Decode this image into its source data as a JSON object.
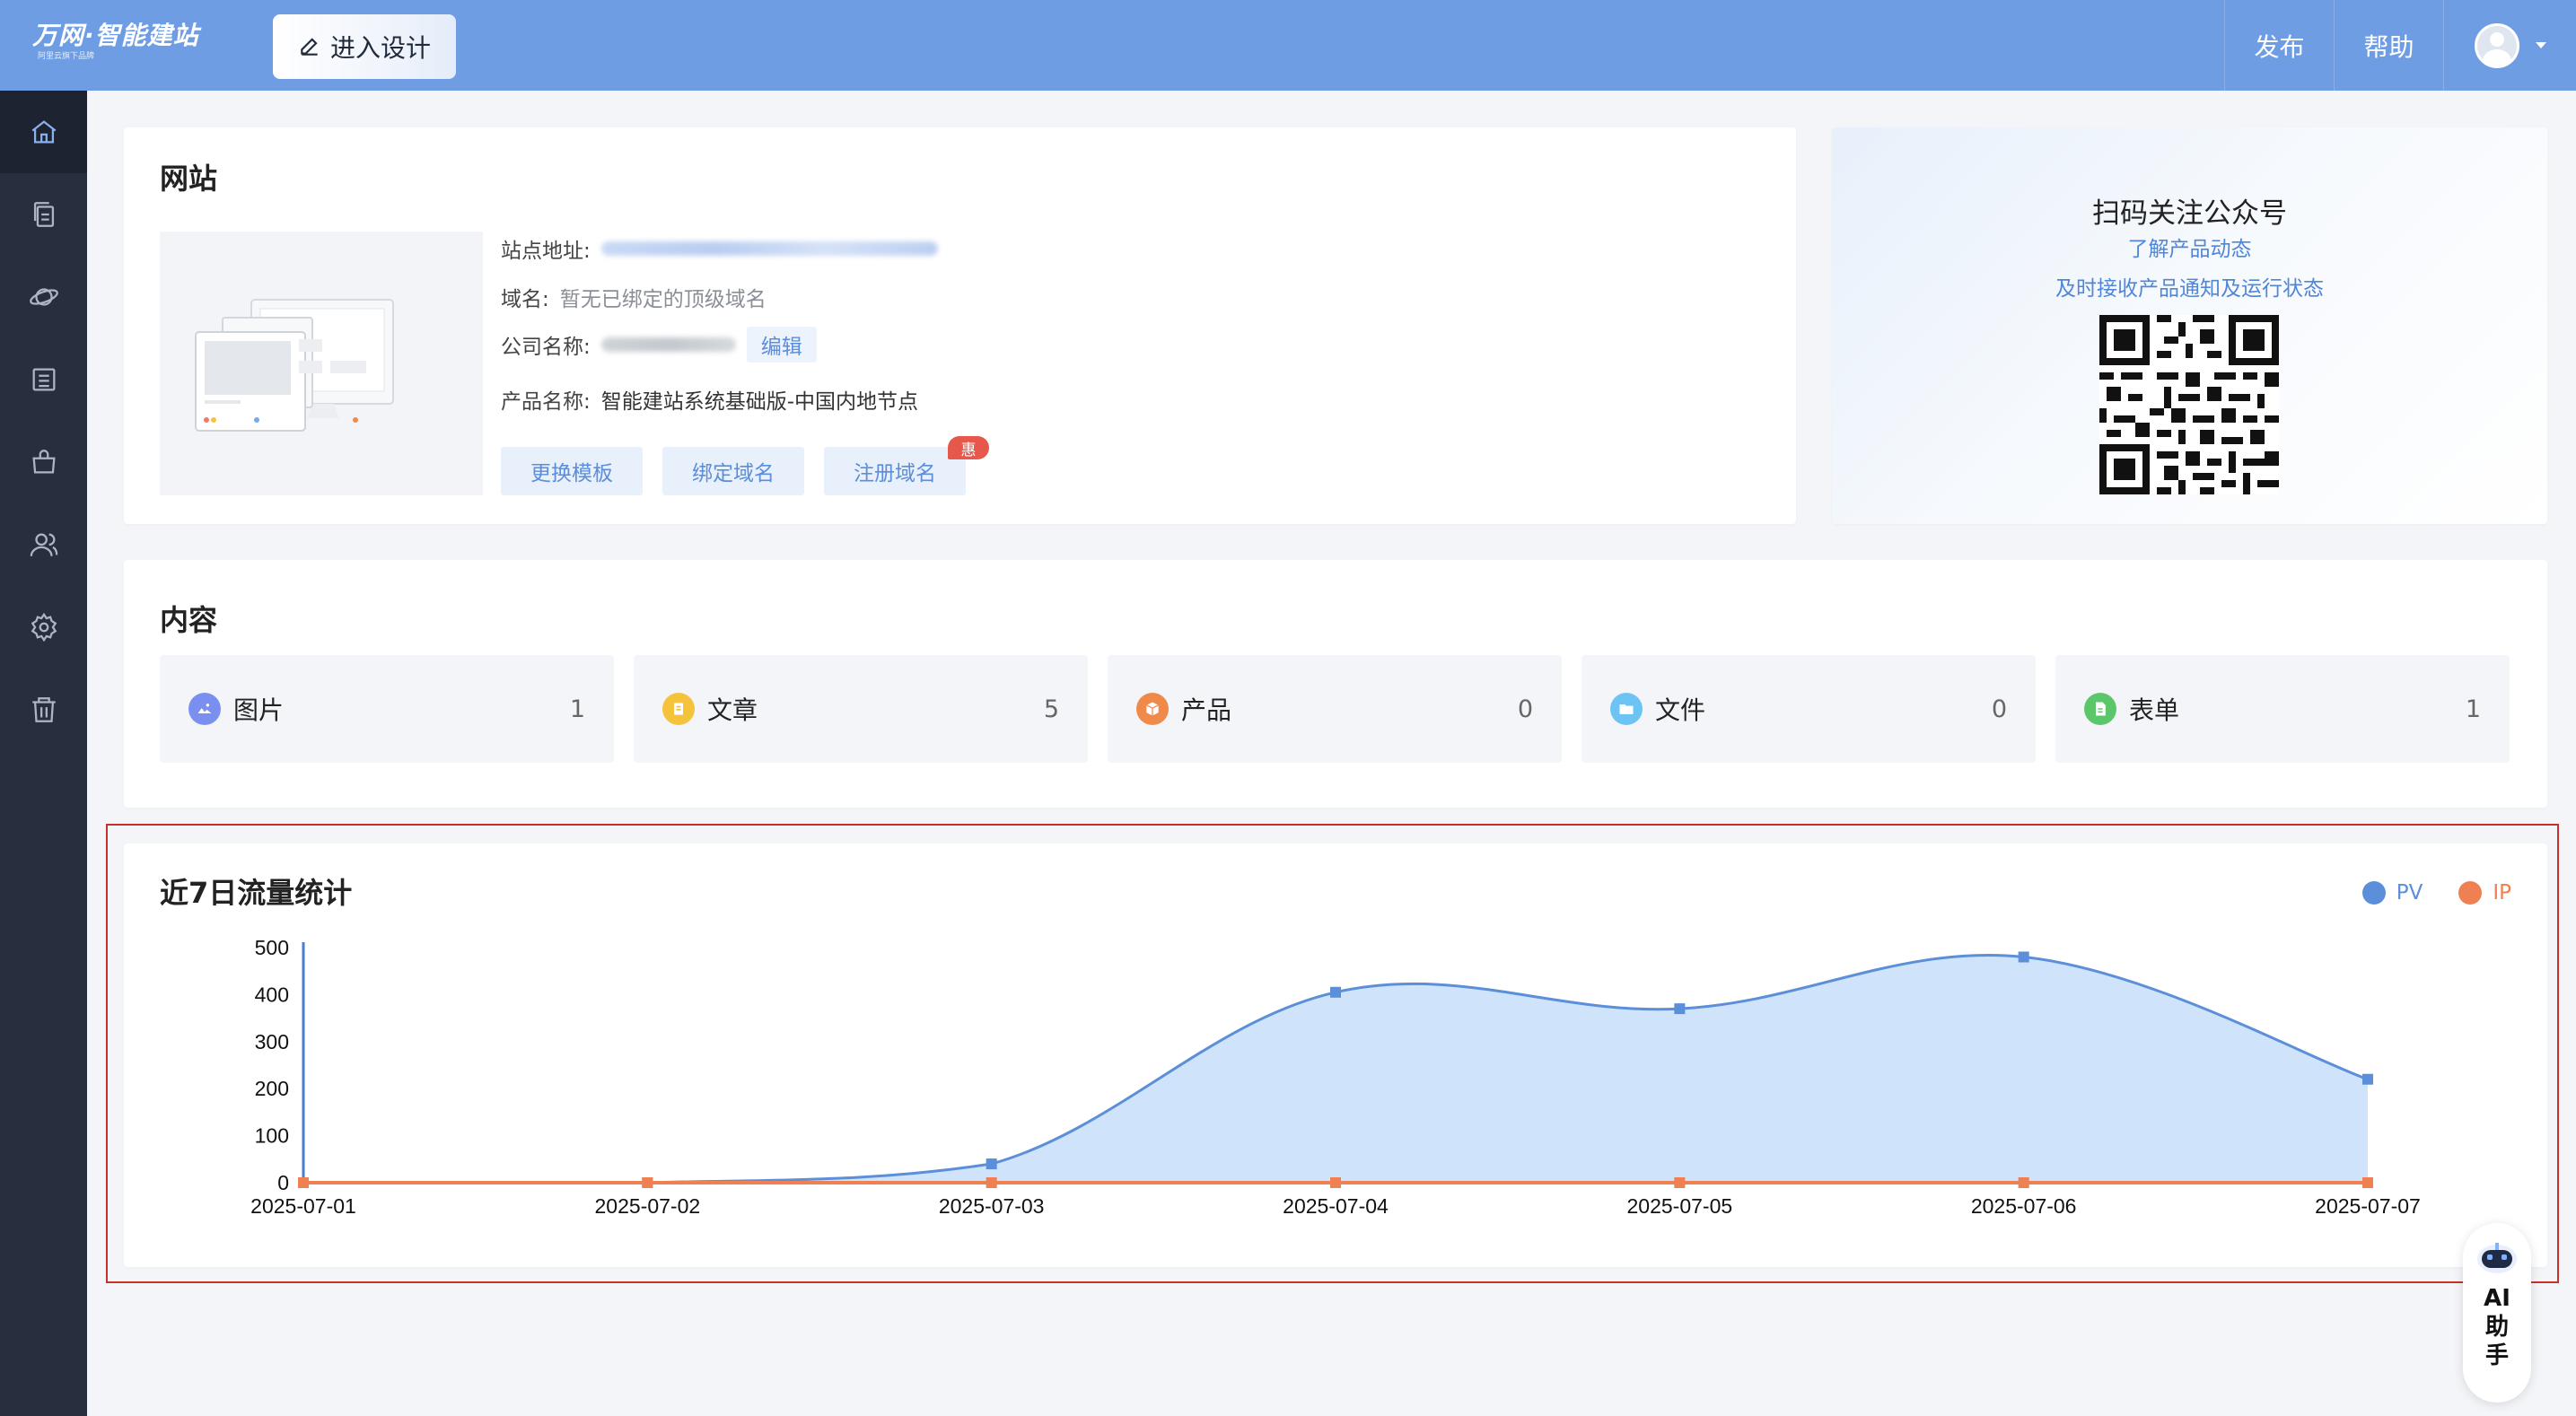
{
  "topbar": {
    "logo_text": "万网·智能建站",
    "logo_sub": "阿里云旗下品牌",
    "design_button": "进入设计",
    "publish": "发布",
    "help": "帮助"
  },
  "sidebar": {
    "items": [
      {
        "icon": "home-icon",
        "active": true
      },
      {
        "icon": "pages-icon"
      },
      {
        "icon": "planet-icon"
      },
      {
        "icon": "list-icon"
      },
      {
        "icon": "shop-icon"
      },
      {
        "icon": "users-icon"
      },
      {
        "icon": "gear-icon"
      },
      {
        "icon": "trash-icon"
      }
    ]
  },
  "website": {
    "title": "网站",
    "site_address_label": "站点地址:",
    "domain_label": "域名:",
    "domain_value": "暂无已绑定的顶级域名",
    "company_label": "公司名称:",
    "edit": "编辑",
    "product_label": "产品名称:",
    "product_value": "智能建站系统基础版-中国内地节点",
    "change_template": "更换模板",
    "bind_domain": "绑定域名",
    "register_domain": "注册域名",
    "badge": "惠"
  },
  "qr": {
    "title": "扫码关注公众号",
    "line1": "了解产品动态",
    "line2": "及时接收产品通知及运行状态"
  },
  "content": {
    "title": "内容",
    "items": [
      {
        "label": "图片",
        "count": "1",
        "color": "#7b8ff0"
      },
      {
        "label": "文章",
        "count": "5",
        "color": "#f5c33b"
      },
      {
        "label": "产品",
        "count": "0",
        "color": "#f08a4b"
      },
      {
        "label": "文件",
        "count": "0",
        "color": "#6cc4f4"
      },
      {
        "label": "表单",
        "count": "1",
        "color": "#5cc66a"
      }
    ]
  },
  "traffic": {
    "title": "近7日流量统计"
  },
  "chart_data": {
    "type": "area",
    "categories": [
      "2025-07-01",
      "2025-07-02",
      "2025-07-03",
      "2025-07-04",
      "2025-07-05",
      "2025-07-06",
      "2025-07-07"
    ],
    "series": [
      {
        "name": "PV",
        "values": [
          0,
          0,
          40,
          405,
          370,
          480,
          220
        ],
        "color": "#5b8fd9"
      },
      {
        "name": "IP",
        "values": [
          0,
          0,
          0,
          0,
          0,
          0,
          0
        ],
        "color": "#ee8052"
      }
    ],
    "y_ticks": [
      0,
      100,
      200,
      300,
      400,
      500
    ],
    "ylim": [
      0,
      500
    ],
    "legend": "top-right",
    "grid": false
  },
  "ai": {
    "label": "AI助手"
  }
}
